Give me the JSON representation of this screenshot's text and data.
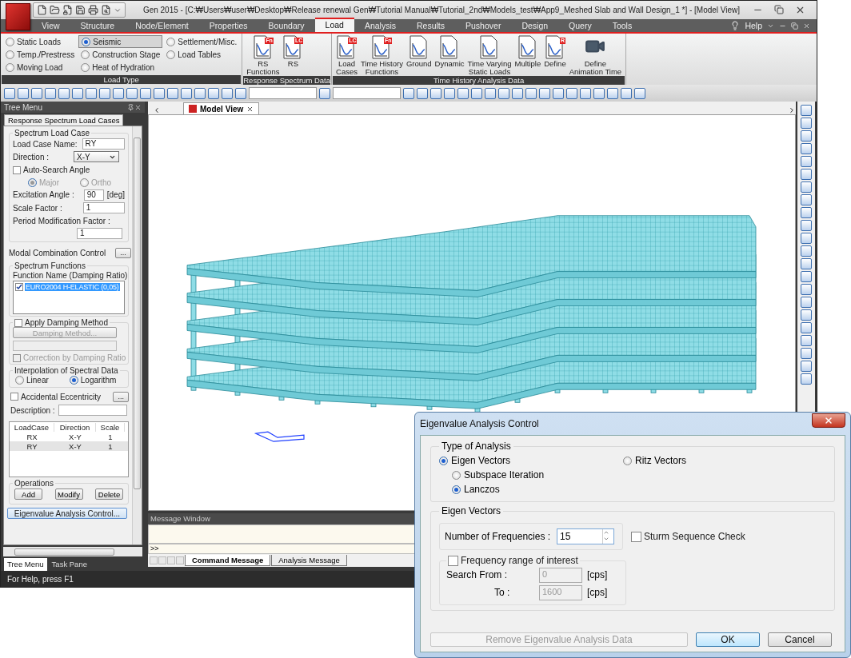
{
  "window": {
    "title": "Gen 2015 - [C:₩Users₩user₩Desktop₩Release renewal Gen₩Tutorial Manual₩Tutorial_2nd₩Models_test₩App9_Meshed Slab and Wall Design_1 *] - [Model View]"
  },
  "menu_tabs": [
    {
      "label": "View",
      "selected": false
    },
    {
      "label": "Structure",
      "selected": false
    },
    {
      "label": "Node/Element",
      "selected": false
    },
    {
      "label": "Properties",
      "selected": false
    },
    {
      "label": "Boundary",
      "selected": false
    },
    {
      "label": "Load",
      "selected": true
    },
    {
      "label": "Analysis",
      "selected": false
    },
    {
      "label": "Results",
      "selected": false
    },
    {
      "label": "Pushover",
      "selected": false
    },
    {
      "label": "Design",
      "selected": false
    },
    {
      "label": "Query",
      "selected": false
    },
    {
      "label": "Tools",
      "selected": false
    }
  ],
  "help": "Help",
  "ribbon": {
    "load_type": {
      "label": "Load Type",
      "options": [
        {
          "label": "Static Loads",
          "selected": false
        },
        {
          "label": "Temp./Prestress",
          "selected": false
        },
        {
          "label": "Moving Load",
          "selected": false
        },
        {
          "label": "Seismic",
          "selected": true
        },
        {
          "label": "Construction Stage",
          "selected": false
        },
        {
          "label": "Heat of Hydration",
          "selected": false
        },
        {
          "label": "Settlement/Misc.",
          "selected": false
        },
        {
          "label": "Load Tables",
          "selected": false
        }
      ]
    },
    "groups": [
      {
        "label": "Response Spectrum Data",
        "buttons": [
          {
            "label": "RS\nFunctions",
            "kind": "doc",
            "badge": "Fn"
          },
          {
            "label": "RS",
            "kind": "doc",
            "badge": "LC"
          }
        ]
      },
      {
        "label": "Time History Analysis Data",
        "buttons": [
          {
            "label": "Load\nCases",
            "kind": "doc",
            "badge": "LC"
          },
          {
            "label": "Time History\nFunctions",
            "kind": "doc",
            "badge": "Fn"
          },
          {
            "label": "Ground",
            "kind": "doc"
          },
          {
            "label": "Dynamic",
            "kind": "doc"
          },
          {
            "label": "Time Varying\nStatic Loads",
            "kind": "doc"
          },
          {
            "label": "Multiple",
            "kind": "doc"
          },
          {
            "label": "Define",
            "kind": "doc",
            "badge": "R"
          },
          {
            "label": "Define\nAnimation Time",
            "kind": "camera"
          }
        ]
      }
    ]
  },
  "tree_menu": {
    "title": "Tree Menu",
    "tab": "Response Spectrum Load Cases"
  },
  "spectrum": {
    "group_title": "Spectrum Load Case",
    "load_case_name": {
      "label": "Load Case Name:",
      "value": "RY"
    },
    "direction": {
      "label": "Direction :",
      "value": "X-Y"
    },
    "auto_search_angle": {
      "label": "Auto-Search Angle",
      "checked": false
    },
    "angle_options": [
      {
        "label": "Major",
        "selected": true,
        "disabled": true
      },
      {
        "label": "Ortho",
        "selected": false,
        "disabled": true
      }
    ],
    "excitation_angle": {
      "label": "Excitation Angle :",
      "value": "90",
      "unit": "[deg]"
    },
    "scale_factor": {
      "label": "Scale Factor :",
      "value": "1"
    },
    "period_modification": {
      "label": "Period Modification Factor :",
      "value": "1"
    },
    "modal_combination": {
      "label": "Modal Combination Control",
      "button": "..."
    },
    "functions": {
      "title": "Spectrum Functions",
      "header": "Function Name (Damping Ratio)",
      "items": [
        {
          "label": "EURO2004 H-ELASTIC (0,05)",
          "checked": true,
          "selected": true
        }
      ]
    },
    "apply_damping": {
      "label": "Apply Damping Method",
      "checked": false
    },
    "damping_button": {
      "label": "Damping Method...",
      "disabled": true
    },
    "correction": {
      "label": "Correction by Damping Ratio",
      "checked": false,
      "disabled": true
    },
    "interpolation": {
      "title": "Interpolation of Spectral Data",
      "options": [
        {
          "label": "Linear",
          "selected": false
        },
        {
          "label": "Logarithm",
          "selected": true
        }
      ]
    },
    "accidental": {
      "label": "Accidental Eccentricity",
      "checked": false,
      "button": "..."
    },
    "description": {
      "label": "Description :"
    },
    "table": {
      "columns": [
        "LoadCase",
        "Direction",
        "Scale"
      ],
      "rows": [
        {
          "cells": [
            "RX",
            "X-Y",
            "1"
          ],
          "selected": false
        },
        {
          "cells": [
            "RY",
            "X-Y",
            "1"
          ],
          "selected": true
        }
      ]
    },
    "operations": {
      "title": "Operations",
      "buttons": [
        "Add",
        "Modify",
        "Delete"
      ]
    },
    "eigen_button": "Eigenvalue Analysis Control..."
  },
  "panel_tabs": [
    {
      "label": "Tree Menu",
      "selected": true
    },
    {
      "label": "Task Pane",
      "selected": false
    }
  ],
  "view_tab": {
    "label": "Model View"
  },
  "message_window": {
    "title": "Message Window",
    "prompt": ">>",
    "tabs": [
      {
        "label": "Command Message",
        "selected": true
      },
      {
        "label": "Analysis Message",
        "selected": false
      }
    ]
  },
  "status_bar": {
    "text": "For Help, press F1"
  },
  "dialog": {
    "title": "Eigenvalue Analysis Control",
    "type_group": "Type of Analysis",
    "types": [
      {
        "label": "Eigen Vectors",
        "selected": true
      },
      {
        "label": "Ritz Vectors",
        "selected": false
      }
    ],
    "methods": [
      {
        "label": "Subspace Iteration",
        "selected": false
      },
      {
        "label": "Lanczos",
        "selected": true
      }
    ],
    "eigen_group": "Eigen Vectors",
    "frequencies": {
      "label": "Number of Frequencies :",
      "value": "15"
    },
    "sturm": {
      "label": "Sturm Sequence Check",
      "checked": false
    },
    "range": {
      "label": "Frequency range of interest",
      "checked": false,
      "from_label": "Search From :",
      "from": "0",
      "from_unit": "[cps]",
      "to_label": "To :",
      "to": "1600",
      "to_unit": "[cps]"
    },
    "buttons": [
      {
        "label": "Remove Eigenvalue Analysis Data",
        "disabled": true,
        "default": false
      },
      {
        "label": "OK",
        "disabled": false,
        "default": true
      },
      {
        "label": "Cancel",
        "disabled": false,
        "default": false
      }
    ]
  }
}
